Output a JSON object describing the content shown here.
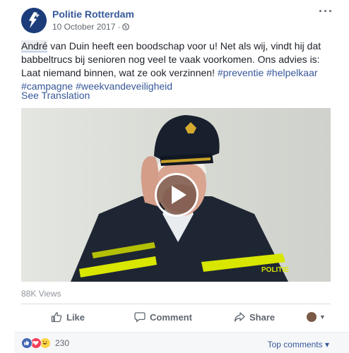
{
  "post": {
    "page_name": "Politie Rotterdam",
    "date": "10 October 2017",
    "separator": "·",
    "more_label": "···",
    "text": {
      "mention": "André",
      "body": " van Duin heeft een boodschap voor u! Net als wij, vindt hij dat babbeltrucs bij senioren nog veel te vaak voorkomen. Ons advies is: Laat niemand binnen, wat ze ook verzinnen! ",
      "hashtags": [
        "#preventie",
        "#helpelkaar",
        "#campagne",
        "#weekvandeveiligheid"
      ]
    },
    "see_translation": "See Translation",
    "video": {
      "shoulder_text": "POLITIE"
    },
    "views": "88K Views"
  },
  "actions": {
    "like": "Like",
    "comment": "Comment",
    "share": "Share"
  },
  "footer": {
    "reaction_count": "230",
    "top_comments": "Top comments",
    "top_comments_caret": "▾"
  },
  "icons": {
    "avatar": "police-badge-icon",
    "visibility": "globe-icon",
    "like": "thumbs-up-icon",
    "comment": "speech-bubble-icon",
    "share": "share-arrow-icon",
    "play": "play-icon"
  },
  "colors": {
    "link": "#365899",
    "brand_blue": "#4267b2",
    "text": "#1d2129",
    "muted": "#606770"
  }
}
